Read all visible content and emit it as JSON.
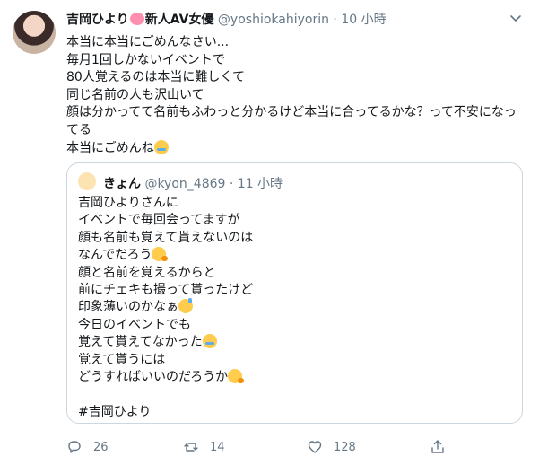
{
  "tweet": {
    "display_name": "吉岡ひより",
    "display_name_suffix": "新人AV女優",
    "handle": "@yoshiokahiyorin",
    "separator": "·",
    "time": "10 小時",
    "lines": [
      "本当に本当にごめんなさい...",
      "毎月1回しかないイベントで",
      "80人覚えるのは本当に難しくて",
      "同じ名前の人も沢山いて",
      "顔は分かってて名前もふわっと分かるけど本当に合ってるかな？って不安になっ",
      "てる",
      "本当にごめんね"
    ]
  },
  "quote": {
    "display_name": "きょん",
    "handle": "@kyon_4869",
    "separator": "·",
    "time": "11 小時",
    "lines": [
      "吉岡ひよりさんに",
      "イベントで毎回会ってますが",
      "顔も名前も覚えて貰えないのは",
      "なんでだろう",
      "顔と名前を覚えるからと",
      "前にチェキも撮って貰ったけど",
      "印象薄いのかなぁ",
      "今日のイベントでも",
      "覚えて貰えてなかった",
      "覚えて貰うには",
      "どうすればいいのだろうか",
      "",
      "#吉岡ひより"
    ]
  },
  "actions": {
    "reply_count": "26",
    "retweet_count": "14",
    "like_count": "128"
  },
  "icons": {
    "reply": "reply-icon",
    "retweet": "retweet-icon",
    "like": "heart-icon",
    "share": "share-icon",
    "more": "chevron-down-icon"
  }
}
